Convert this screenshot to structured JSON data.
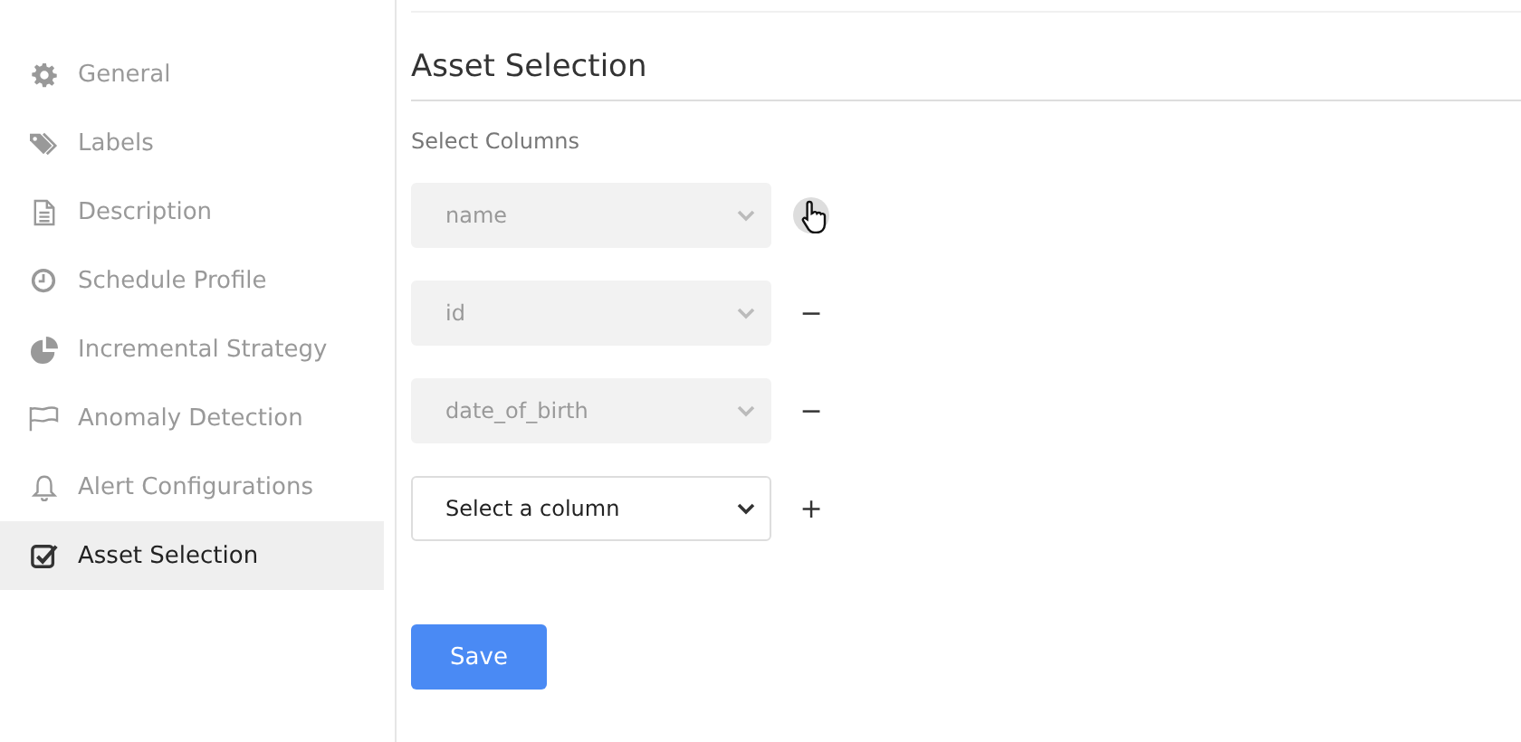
{
  "sidebar": {
    "items": [
      {
        "label": "General",
        "selected": false
      },
      {
        "label": "Labels",
        "selected": false
      },
      {
        "label": "Description",
        "selected": false
      },
      {
        "label": "Schedule Profile",
        "selected": false
      },
      {
        "label": "Incremental Strategy",
        "selected": false
      },
      {
        "label": "Anomaly Detection",
        "selected": false
      },
      {
        "label": "Alert Configurations",
        "selected": false
      },
      {
        "label": "Asset Selection",
        "selected": true
      }
    ]
  },
  "main": {
    "title": "Asset Selection",
    "section_label": "Select Columns",
    "rows": [
      {
        "value": "name",
        "disabled": true,
        "hovered": true
      },
      {
        "value": "id",
        "disabled": true,
        "hovered": false,
        "action": "−"
      },
      {
        "value": "date_of_birth",
        "disabled": true,
        "hovered": false,
        "action": "−"
      },
      {
        "value": "Select a column",
        "disabled": false,
        "hovered": false,
        "action": "+"
      }
    ],
    "save_button": "Save"
  }
}
